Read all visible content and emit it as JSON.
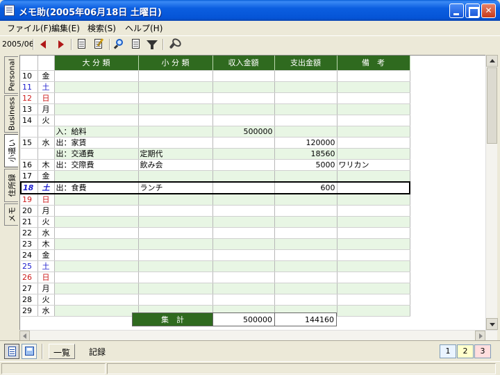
{
  "window": {
    "title": "メモ助(2005年06月18日 土曜日)"
  },
  "menu": [
    "ファイル(F)",
    "編集(E)",
    "検索(S)",
    "ヘルプ(H)"
  ],
  "toolbar": {
    "month": "2005/06"
  },
  "side_tabs": [
    "Personal",
    "Business",
    "小遣い",
    "住所録",
    "メモ"
  ],
  "columns": [
    "大 分 類",
    "小 分 類",
    "収入金額",
    "支出金額",
    "備　考"
  ],
  "rows": [
    {
      "day": "10",
      "wd": "金",
      "kind": "",
      "major": "",
      "minor": "",
      "income": "",
      "expense": "",
      "note": ""
    },
    {
      "day": "11",
      "wd": "土",
      "kind": "sat",
      "major": "",
      "minor": "",
      "income": "",
      "expense": "",
      "note": ""
    },
    {
      "day": "12",
      "wd": "日",
      "kind": "sun",
      "major": "",
      "minor": "",
      "income": "",
      "expense": "",
      "note": ""
    },
    {
      "day": "13",
      "wd": "月",
      "kind": "",
      "major": "",
      "minor": "",
      "income": "",
      "expense": "",
      "note": ""
    },
    {
      "day": "14",
      "wd": "火",
      "kind": "",
      "major": "",
      "minor": "",
      "income": "",
      "expense": "",
      "note": ""
    },
    {
      "day": "",
      "wd": "",
      "kind": "",
      "major": "入：給料",
      "minor": "",
      "income": "500000",
      "expense": "",
      "note": ""
    },
    {
      "day": "15",
      "wd": "水",
      "kind": "",
      "major": "出：家賃",
      "minor": "",
      "income": "",
      "expense": "120000",
      "note": ""
    },
    {
      "day": "",
      "wd": "",
      "kind": "",
      "major": "出：交通費",
      "minor": "定期代",
      "income": "",
      "expense": "18560",
      "note": ""
    },
    {
      "day": "16",
      "wd": "木",
      "kind": "",
      "major": "出：交際費",
      "minor": "飲み会",
      "income": "",
      "expense": "5000",
      "note": "ワリカン"
    },
    {
      "day": "17",
      "wd": "金",
      "kind": "",
      "major": "",
      "minor": "",
      "income": "",
      "expense": "",
      "note": ""
    },
    {
      "day": "18",
      "wd": "土",
      "kind": "sat",
      "major": "出：食費",
      "minor": "ランチ",
      "income": "",
      "expense": "600",
      "note": "",
      "selected": true
    },
    {
      "day": "19",
      "wd": "日",
      "kind": "sun",
      "major": "",
      "minor": "",
      "income": "",
      "expense": "",
      "note": ""
    },
    {
      "day": "20",
      "wd": "月",
      "kind": "",
      "major": "",
      "minor": "",
      "income": "",
      "expense": "",
      "note": ""
    },
    {
      "day": "21",
      "wd": "火",
      "kind": "",
      "major": "",
      "minor": "",
      "income": "",
      "expense": "",
      "note": ""
    },
    {
      "day": "22",
      "wd": "水",
      "kind": "",
      "major": "",
      "minor": "",
      "income": "",
      "expense": "",
      "note": ""
    },
    {
      "day": "23",
      "wd": "木",
      "kind": "",
      "major": "",
      "minor": "",
      "income": "",
      "expense": "",
      "note": ""
    },
    {
      "day": "24",
      "wd": "金",
      "kind": "",
      "major": "",
      "minor": "",
      "income": "",
      "expense": "",
      "note": ""
    },
    {
      "day": "25",
      "wd": "土",
      "kind": "sat",
      "major": "",
      "minor": "",
      "income": "",
      "expense": "",
      "note": ""
    },
    {
      "day": "26",
      "wd": "日",
      "kind": "sun",
      "major": "",
      "minor": "",
      "income": "",
      "expense": "",
      "note": ""
    },
    {
      "day": "27",
      "wd": "月",
      "kind": "",
      "major": "",
      "minor": "",
      "income": "",
      "expense": "",
      "note": ""
    },
    {
      "day": "28",
      "wd": "火",
      "kind": "",
      "major": "",
      "minor": "",
      "income": "",
      "expense": "",
      "note": ""
    },
    {
      "day": "29",
      "wd": "水",
      "kind": "",
      "major": "",
      "minor": "",
      "income": "",
      "expense": "",
      "note": ""
    }
  ],
  "totals": {
    "label": "集　計",
    "income": "500000",
    "expense": "144160"
  },
  "bottom": {
    "tab_list": "一覧",
    "tab_record": "記録",
    "pages": [
      "1",
      "2",
      "3"
    ]
  },
  "colors": {
    "header_green": "#2f6a1f",
    "row_alt": "#e8f6e4",
    "saturday": "#1a1acc",
    "sunday": "#cc1a1a",
    "page1": "#eaf4ff",
    "page2": "#ffffcc",
    "page3": "#ffdede"
  },
  "icons": [
    "prev-month-icon",
    "next-month-icon",
    "new-document-icon",
    "edit-document-icon",
    "search-icon",
    "search-record-icon",
    "filter-icon",
    "settings-wrench-icon",
    "list-view-icon",
    "record-view-icon"
  ]
}
